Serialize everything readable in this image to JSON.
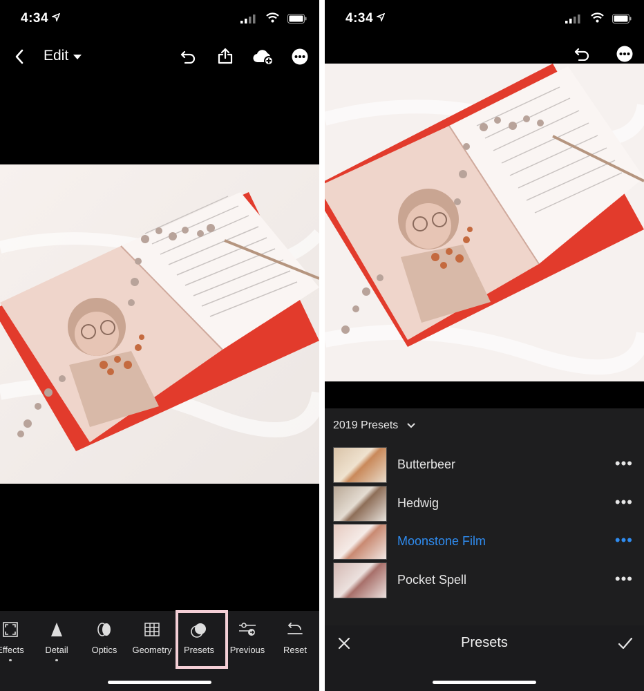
{
  "left_screen": {
    "status": {
      "time": "4:34"
    },
    "nav": {
      "title": "Edit"
    },
    "toolbar": [
      {
        "label": "Effects",
        "icon": "effects-icon"
      },
      {
        "label": "Detail",
        "icon": "detail-icon"
      },
      {
        "label": "Optics",
        "icon": "optics-icon"
      },
      {
        "label": "Geometry",
        "icon": "geometry-icon"
      },
      {
        "label": "Presets",
        "icon": "presets-icon"
      },
      {
        "label": "Previous",
        "icon": "previous-icon"
      },
      {
        "label": "Reset",
        "icon": "reset-icon"
      }
    ],
    "highlight_color": "#f4cfd6"
  },
  "right_screen": {
    "status": {
      "time": "4:34"
    },
    "presets_group": "2019 Presets",
    "presets": [
      {
        "name": "Butterbeer",
        "selected": false
      },
      {
        "name": "Hedwig",
        "selected": false
      },
      {
        "name": "Moonstone Film",
        "selected": true
      },
      {
        "name": "Pocket Spell",
        "selected": false
      }
    ],
    "more_label": "•••",
    "bottom_title": "Presets",
    "accent_color": "#2f8cf0"
  }
}
